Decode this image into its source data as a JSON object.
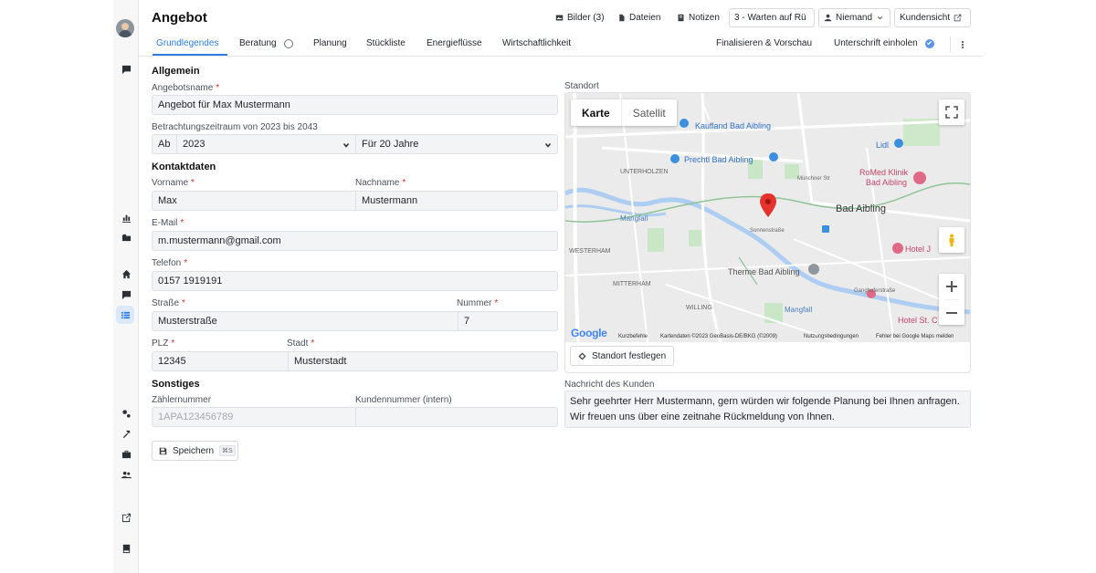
{
  "header": {
    "title": "Angebot",
    "images_label": "Bilder (3)",
    "files_label": "Dateien",
    "notes_label": "Notizen",
    "status_value": "3 - Warten auf Rü",
    "assignee_value": "Niemand",
    "customer_view_label": "Kundensicht"
  },
  "tabs": {
    "items": [
      {
        "label": "Grundlegendes"
      },
      {
        "label": "Beratung"
      },
      {
        "label": "Planung"
      },
      {
        "label": "Stückliste"
      },
      {
        "label": "Energieflüsse"
      },
      {
        "label": "Wirtschaftlichkeit"
      },
      {
        "label": "Finalisieren & Vorschau"
      },
      {
        "label": "Unterschrift einholen"
      }
    ]
  },
  "form": {
    "general_heading": "Allgemein",
    "offer_name_label": "Angebotsname",
    "offer_name_value": "Angebot für Max Mustermann",
    "period_label": "Betrachtungszeitraum von 2023 bis 2043",
    "period_prefix": "Ab",
    "period_year_value": "2023",
    "period_duration_value": "Für 20 Jahre",
    "contact_heading": "Kontaktdaten",
    "firstname_label": "Vorname",
    "firstname_value": "Max",
    "lastname_label": "Nachname",
    "lastname_value": "Mustermann",
    "email_label": "E-Mail",
    "email_value": "m.mustermann@gmail.com",
    "phone_label": "Telefon",
    "phone_value": "0157 1919191",
    "street_label": "Straße",
    "street_value": "Musterstraße",
    "number_label": "Nummer",
    "number_value": "7",
    "zip_label": "PLZ",
    "zip_value": "12345",
    "city_label": "Stadt",
    "city_value": "Musterstadt",
    "misc_heading": "Sonstiges",
    "meter_label": "Zählernummer",
    "meter_value": "1APA123456789",
    "customer_no_label": "Kundennummer (intern)",
    "customer_no_value": "",
    "required_mark": "*",
    "save_label": "Speichern",
    "save_shortcut": "⌘S"
  },
  "location": {
    "label": "Standort",
    "map_type_map": "Karte",
    "map_type_satellite": "Satellit",
    "set_location_label": "Standort festlegen",
    "map_labels": {
      "kaufland": "Kaufland Bad Aibling",
      "prechtl": "Prechtl Bad Aibling",
      "lidl": "Lidl",
      "romed_1": "RoMed Klinik",
      "romed_2": "Bad Aibling",
      "bad_aibling": "Bad Aibling",
      "therme": "Therme Bad Aibling",
      "hotel_j": "Hotel J",
      "hotel_st": "Hotel St. C",
      "unterholzen": "UNTERHOLZEN",
      "westerham": "WESTERHAM",
      "mitterham": "MITTERHAM",
      "willing": "WILLING",
      "mangfall_1": "Mangfall",
      "mangfall_2": "Mangfall",
      "muenchner_str": "Münchner Str",
      "sonnenstrasse": "Sonnenstraße",
      "ganghoferstrasse": "Ganghoferstraße"
    },
    "footer": {
      "google": "Google",
      "shortcuts": "Kurzbefehle",
      "map_data": "Kartendaten ©2023 GeoBasis-DE/BKG (©2009)",
      "terms": "Nutzungsbedingungen",
      "report": "Fehler bei Google Maps melden"
    }
  },
  "message": {
    "label": "Nachricht des Kunden",
    "text": "Sehr geehrter Herr Mustermann, gern würden wir folgende Planung bei Ihnen anfragen. Wir freuen uns über eine zeitnahe Rückmeldung von Ihnen."
  },
  "colors": {
    "accent": "#2d7be5",
    "required": "#d9352b",
    "map_pin": "#e5322c"
  }
}
